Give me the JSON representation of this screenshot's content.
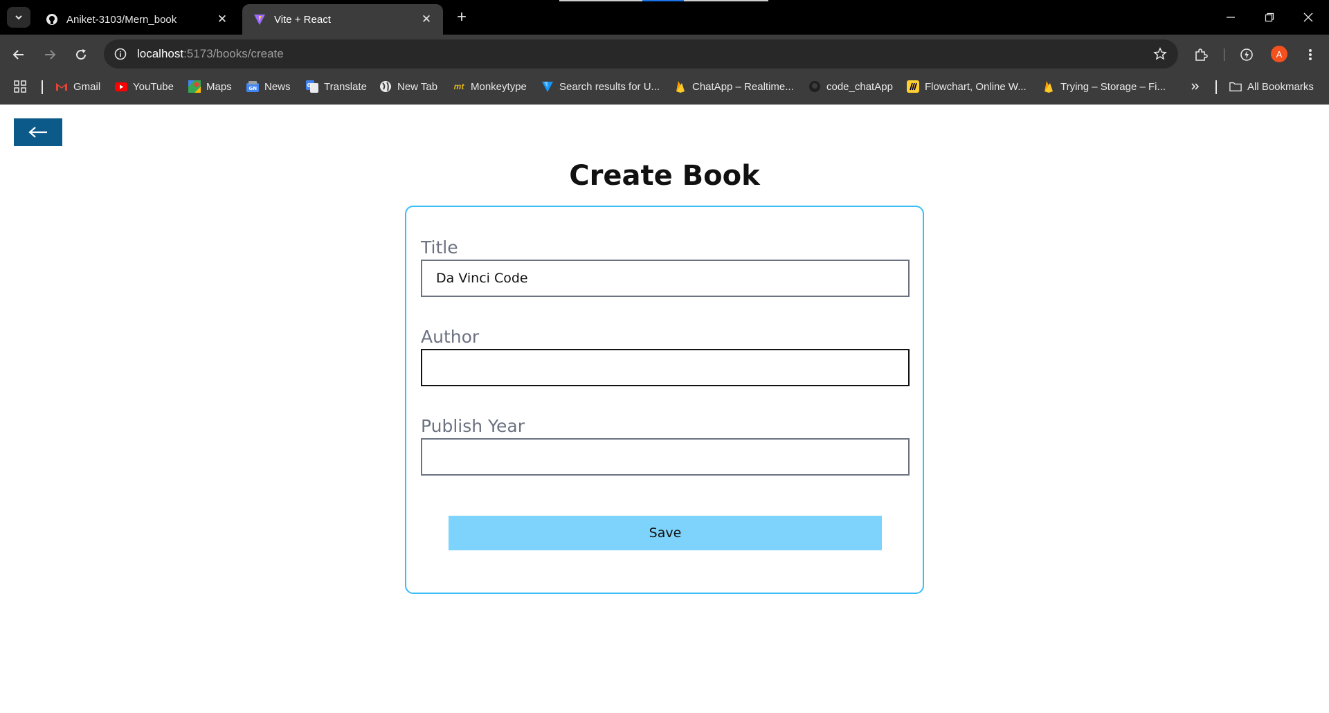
{
  "browser": {
    "tabs": [
      {
        "title": "Aniket-3103/Mern_book",
        "favicon": "github-icon",
        "active": false
      },
      {
        "title": "Vite + React",
        "favicon": "vite-icon",
        "active": true
      }
    ],
    "omnibox": {
      "host": "localhost",
      "path": ":5173/books/create"
    },
    "avatar_initial": "A",
    "bookmarks": [
      {
        "label": "Gmail",
        "icon": "gmail-icon"
      },
      {
        "label": "YouTube",
        "icon": "youtube-icon"
      },
      {
        "label": "Maps",
        "icon": "maps-icon"
      },
      {
        "label": "News",
        "icon": "news-icon"
      },
      {
        "label": "Translate",
        "icon": "translate-icon"
      },
      {
        "label": "New Tab",
        "icon": "globe-icon"
      },
      {
        "label": "Monkeytype",
        "icon": "monkeytype-icon"
      },
      {
        "label": "Search results for U...",
        "icon": "vuetify-icon"
      },
      {
        "label": "ChatApp – Realtime...",
        "icon": "firebase-icon"
      },
      {
        "label": "code_chatApp",
        "icon": "github-icon"
      },
      {
        "label": "Flowchart, Online W...",
        "icon": "miro-icon"
      },
      {
        "label": "Trying – Storage – Fi...",
        "icon": "firebase-icon"
      }
    ],
    "all_bookmarks_label": "All Bookmarks"
  },
  "page": {
    "title": "Create Book",
    "fields": {
      "title": {
        "label": "Title",
        "value": "Da Vinci Code"
      },
      "author": {
        "label": "Author",
        "value": ""
      },
      "publish_year": {
        "label": "Publish Year",
        "value": ""
      }
    },
    "save_label": "Save"
  },
  "colors": {
    "back_button": "#0c5a8a",
    "card_border": "#38bdf8",
    "save_button": "#7dd3fc"
  }
}
